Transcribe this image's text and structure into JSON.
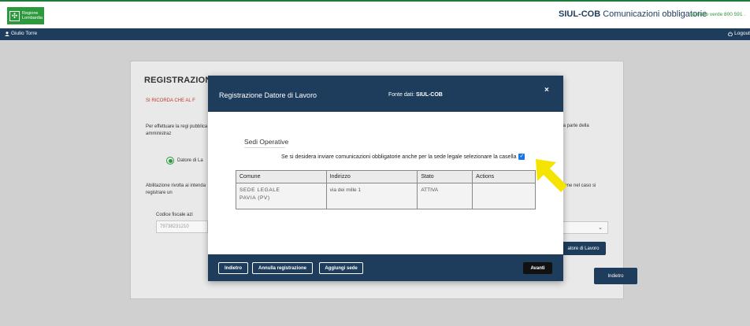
{
  "header": {
    "logo_line1": "Regione",
    "logo_line2": "Lombardia",
    "app_title": "SIUL-COB",
    "app_subtitle": "Comunicazioni obbligatorie",
    "numero_verde": "Numero verde 800 591 ."
  },
  "userbar": {
    "user_name": "Giulio Torre",
    "logout_label": "Logout"
  },
  "background_form": {
    "title": "REGISTRAZIONE",
    "notice": "SI RICORDA CHE AL F",
    "paragraph1": "Per effettuare la regi pubblica amministraz",
    "paragraph1_right": "fa parte della",
    "radio_label": "Datore di La",
    "paragraph2": "Abilitazione rivolta ai intenda registrare un",
    "paragraph2_right": "zione nel caso si",
    "cf_label": "Codice fiscale azi",
    "cf_value": "79738231210",
    "btn_datore": "atore di Lavoro",
    "btn_indietro": "Indietro"
  },
  "modal": {
    "title": "Registrazione Datore di Lavoro",
    "source_label": "Fonte dati:",
    "source_value": "SIUL-COB",
    "close": "×",
    "section_title": "Sedi Operative",
    "checkbox_text": "Se si desidera inviare comunicazioni obbligatorie anche per la sede legale selezionare la casella",
    "checkbox_checked": true,
    "table": {
      "headers": [
        "Comune",
        "Indirizzo",
        "Stato",
        "Actions"
      ],
      "rows": [
        {
          "comune_line1": "SEDE LEGALE",
          "comune_line2": "PAVIA (PV)",
          "indirizzo": "via dei mille 1",
          "stato": "ATTIVA",
          "actions": ""
        }
      ]
    },
    "footer": {
      "indietro": "Indietro",
      "annulla": "Annulla registrazione",
      "aggiungi": "Aggiungi sede",
      "avanti": "Avanti"
    }
  },
  "colors": {
    "navy": "#1e3c5c",
    "brand_green": "#2c9a3c",
    "notice_red": "#c0392b",
    "checkbox_blue": "#1a73e8",
    "arrow_yellow": "#f5e400"
  },
  "icons": {
    "user": "user-icon",
    "logout": "power-icon",
    "close": "close-icon",
    "check": "check-icon",
    "chevron": "chevron-down-icon",
    "pointer": "arrow-pointer-icon"
  }
}
